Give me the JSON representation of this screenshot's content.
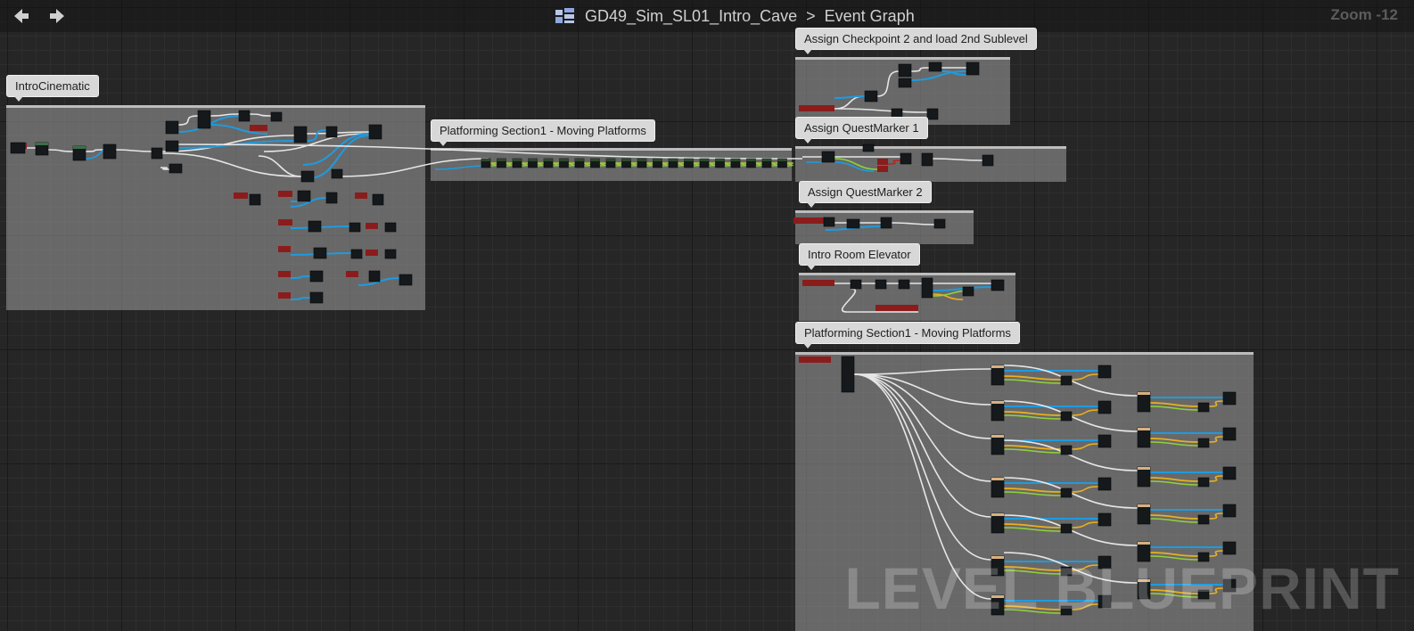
{
  "header": {
    "back_icon": "arrow-left-icon",
    "forward_icon": "arrow-right-icon",
    "blueprint_icon": "blueprint-icon",
    "level_name": "GD49_Sim_SL01_Intro_Cave",
    "separator": ">",
    "graph_name": "Event Graph",
    "zoom": "Zoom -12"
  },
  "watermark": "LEVEL BLUEPRINT",
  "comments": [
    {
      "label": "IntroCinematic"
    },
    {
      "label": "Platforming Section1 - Moving Platforms"
    },
    {
      "label": "Assign Checkpoint 2 and load 2nd Sublevel"
    },
    {
      "label": "Assign QuestMarker 1"
    },
    {
      "label": "Assign QuestMarker 2"
    },
    {
      "label": "Intro Room Elevator"
    },
    {
      "label": "Platforming Section1 - Moving Platforms"
    }
  ],
  "colors": {
    "graph_bg": "#262626",
    "comment_fill": "#919191",
    "exec_wire": "#e6e6e6",
    "object_wire": "#1e9be0",
    "float_wire": "#e8b020",
    "bool_wire": "#8fd23a",
    "event_node_header": "#8b1c1c",
    "node_body": "#15191c"
  }
}
